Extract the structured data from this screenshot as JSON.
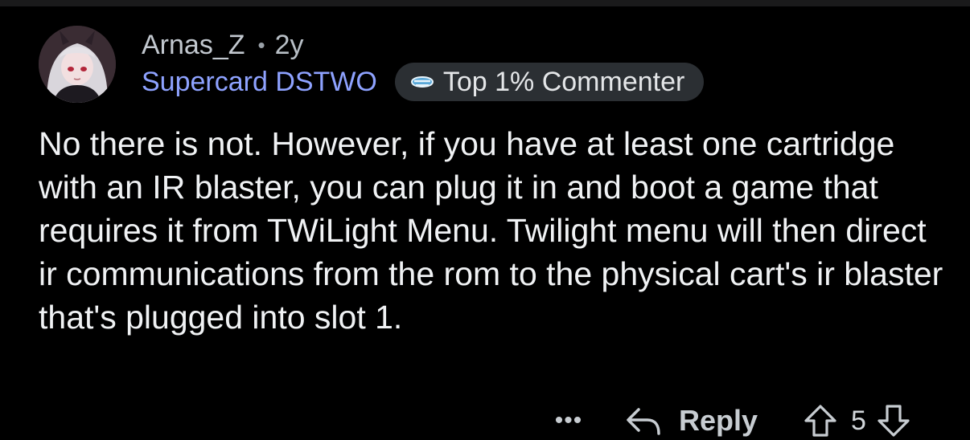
{
  "comment": {
    "username": "Arnas_Z",
    "separator": "•",
    "age": "2y",
    "flair": "Supercard DSTWO",
    "badge": {
      "icon": "commenter-badge-icon",
      "label": "Top 1% Commenter"
    },
    "body": "No there is not. However, if you have at least one cartridge with an IR blaster, you can plug it in and boot a game that requires it from TWiLight Menu. Twilight menu will then direct ir communications from the rom to the physical cart's ir blaster that's plugged into slot 1.",
    "actions": {
      "more": "•••",
      "reply": "Reply",
      "score": "5"
    }
  },
  "colors": {
    "background": "#000000",
    "flair": "#8ea2ff",
    "badge_bg": "#2b2f33",
    "text": "#f0f2f4",
    "muted": "#b8bfc6"
  }
}
